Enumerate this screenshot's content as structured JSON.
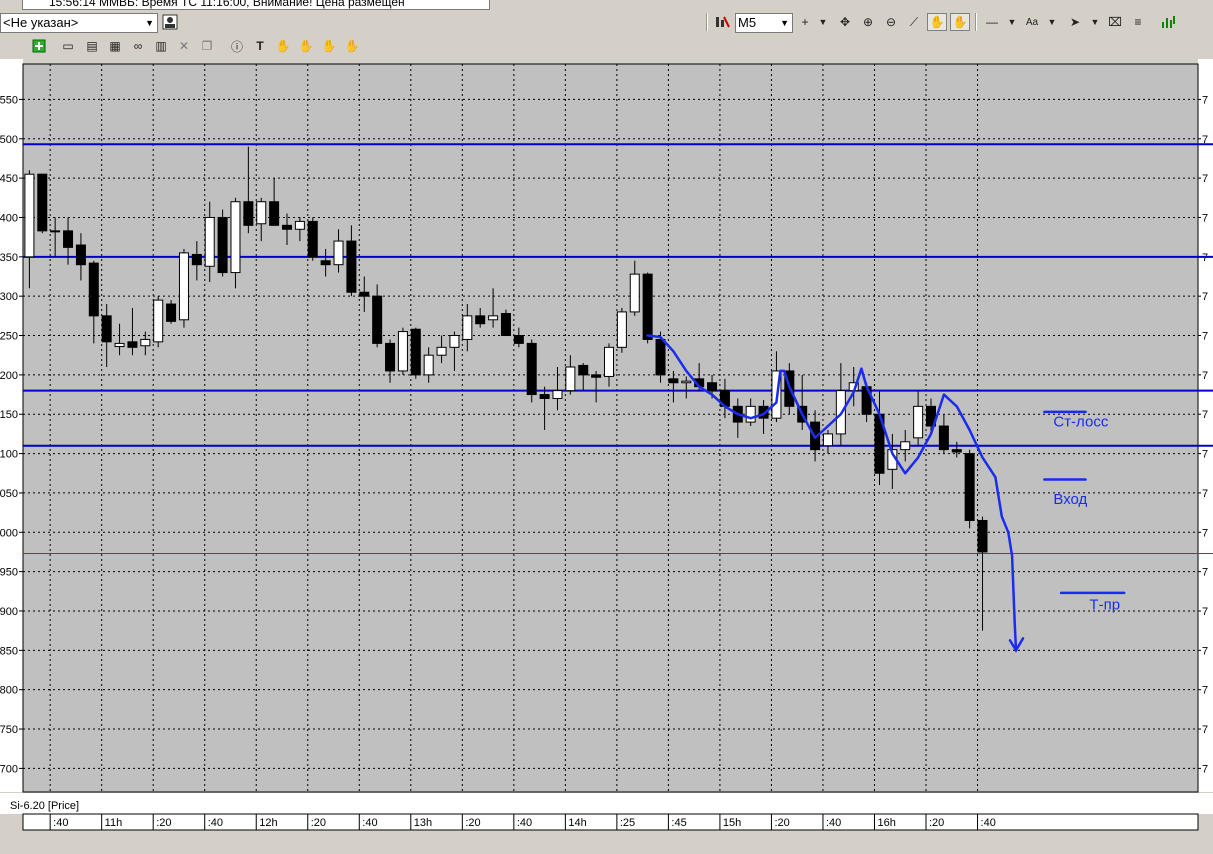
{
  "window": {
    "title": "15:56:14 ММВБ: Время ТС   11:16:00, Внимание! Цена размещен"
  },
  "toolbar": {
    "instrument_select": "<Не указан>",
    "timeframe_select": "M5"
  },
  "colors": {
    "plot_bg": "#c0c0c0",
    "grid": "#000000",
    "level_line": "#0000cc",
    "current_price_line": "#ff0000",
    "annotation": "#1a2cf0",
    "candle_up": "#ffffff",
    "candle_down": "#000000"
  },
  "chart_data": {
    "type": "candlestick",
    "series_label": "Si-6.20 [Price]",
    "price_axis_left_labels": [
      {
        "price": 550,
        "text": "550"
      },
      {
        "price": 500,
        "text": "500"
      },
      {
        "price": 450,
        "text": "450"
      },
      {
        "price": 400,
        "text": "400"
      },
      {
        "price": 350,
        "text": "350"
      },
      {
        "price": 300,
        "text": "300"
      },
      {
        "price": 250,
        "text": "250"
      },
      {
        "price": 200,
        "text": "200"
      },
      {
        "price": 150,
        "text": "150"
      },
      {
        "price": 100,
        "text": "100"
      },
      {
        "price": 50,
        "text": "050"
      },
      {
        "price": 0,
        "text": "000"
      },
      {
        "price": -50,
        "text": "950"
      },
      {
        "price": -100,
        "text": "900"
      },
      {
        "price": -150,
        "text": "850"
      },
      {
        "price": -200,
        "text": "800"
      },
      {
        "price": -250,
        "text": "750"
      },
      {
        "price": -300,
        "text": "700"
      }
    ],
    "price_axis_right_label": "7",
    "ylim": [
      -330,
      595
    ],
    "time_axis_labels": [
      {
        "slot": 2,
        "text": ":40"
      },
      {
        "slot": 6,
        "text": "11h"
      },
      {
        "slot": 10,
        "text": ":20"
      },
      {
        "slot": 14,
        "text": ":40"
      },
      {
        "slot": 18,
        "text": "12h"
      },
      {
        "slot": 22,
        "text": ":20"
      },
      {
        "slot": 26,
        "text": ":40"
      },
      {
        "slot": 30,
        "text": "13h"
      },
      {
        "slot": 34,
        "text": ":20"
      },
      {
        "slot": 38,
        "text": ":40"
      },
      {
        "slot": 42,
        "text": "14h"
      },
      {
        "slot": 46,
        "text": ":25"
      },
      {
        "slot": 50,
        "text": ":45"
      },
      {
        "slot": 54,
        "text": "15h"
      },
      {
        "slot": 58,
        "text": ":20"
      },
      {
        "slot": 62,
        "text": ":40"
      },
      {
        "slot": 66,
        "text": "16h"
      },
      {
        "slot": 70,
        "text": ":20"
      },
      {
        "slot": 74,
        "text": ":40"
      }
    ],
    "candles": [
      {
        "o": 350,
        "h": 460,
        "l": 310,
        "c": 455
      },
      {
        "o": 455,
        "h": 455,
        "l": 380,
        "c": 383
      },
      {
        "o": 383,
        "h": 400,
        "l": 350,
        "c": 383
      },
      {
        "o": 383,
        "h": 400,
        "l": 340,
        "c": 362
      },
      {
        "o": 365,
        "h": 380,
        "l": 320,
        "c": 340
      },
      {
        "o": 342,
        "h": 345,
        "l": 240,
        "c": 275
      },
      {
        "o": 275,
        "h": 290,
        "l": 210,
        "c": 242
      },
      {
        "o": 236,
        "h": 265,
        "l": 225,
        "c": 240
      },
      {
        "o": 242,
        "h": 285,
        "l": 225,
        "c": 235
      },
      {
        "o": 237,
        "h": 255,
        "l": 225,
        "c": 245
      },
      {
        "o": 242,
        "h": 300,
        "l": 235,
        "c": 295
      },
      {
        "o": 290,
        "h": 295,
        "l": 265,
        "c": 268
      },
      {
        "o": 270,
        "h": 360,
        "l": 260,
        "c": 355
      },
      {
        "o": 353,
        "h": 370,
        "l": 320,
        "c": 340
      },
      {
        "o": 338,
        "h": 420,
        "l": 318,
        "c": 400
      },
      {
        "o": 400,
        "h": 410,
        "l": 325,
        "c": 330
      },
      {
        "o": 330,
        "h": 425,
        "l": 310,
        "c": 420
      },
      {
        "o": 420,
        "h": 490,
        "l": 380,
        "c": 390
      },
      {
        "o": 392,
        "h": 425,
        "l": 370,
        "c": 420
      },
      {
        "o": 420,
        "h": 450,
        "l": 390,
        "c": 390
      },
      {
        "o": 390,
        "h": 405,
        "l": 365,
        "c": 385
      },
      {
        "o": 385,
        "h": 400,
        "l": 370,
        "c": 395
      },
      {
        "o": 395,
        "h": 400,
        "l": 345,
        "c": 350
      },
      {
        "o": 345,
        "h": 360,
        "l": 325,
        "c": 340
      },
      {
        "o": 340,
        "h": 385,
        "l": 330,
        "c": 370
      },
      {
        "o": 370,
        "h": 390,
        "l": 300,
        "c": 305
      },
      {
        "o": 305,
        "h": 325,
        "l": 280,
        "c": 300
      },
      {
        "o": 300,
        "h": 315,
        "l": 235,
        "c": 240
      },
      {
        "o": 240,
        "h": 245,
        "l": 190,
        "c": 205
      },
      {
        "o": 205,
        "h": 260,
        "l": 200,
        "c": 255
      },
      {
        "o": 258,
        "h": 260,
        "l": 195,
        "c": 200
      },
      {
        "o": 200,
        "h": 235,
        "l": 190,
        "c": 225
      },
      {
        "o": 225,
        "h": 250,
        "l": 215,
        "c": 235
      },
      {
        "o": 235,
        "h": 255,
        "l": 205,
        "c": 250
      },
      {
        "o": 245,
        "h": 290,
        "l": 230,
        "c": 275
      },
      {
        "o": 275,
        "h": 285,
        "l": 260,
        "c": 265
      },
      {
        "o": 270,
        "h": 310,
        "l": 260,
        "c": 275
      },
      {
        "o": 278,
        "h": 283,
        "l": 255,
        "c": 250
      },
      {
        "o": 250,
        "h": 260,
        "l": 235,
        "c": 240
      },
      {
        "o": 240,
        "h": 245,
        "l": 165,
        "c": 175
      },
      {
        "o": 175,
        "h": 185,
        "l": 130,
        "c": 170
      },
      {
        "o": 170,
        "h": 210,
        "l": 155,
        "c": 180
      },
      {
        "o": 180,
        "h": 225,
        "l": 175,
        "c": 210
      },
      {
        "o": 212,
        "h": 215,
        "l": 180,
        "c": 200
      },
      {
        "o": 200,
        "h": 205,
        "l": 165,
        "c": 197
      },
      {
        "o": 198,
        "h": 240,
        "l": 185,
        "c": 235
      },
      {
        "o": 235,
        "h": 285,
        "l": 228,
        "c": 280
      },
      {
        "o": 280,
        "h": 345,
        "l": 275,
        "c": 328
      },
      {
        "o": 328,
        "h": 330,
        "l": 240,
        "c": 245
      },
      {
        "o": 245,
        "h": 255,
        "l": 190,
        "c": 200
      },
      {
        "o": 195,
        "h": 205,
        "l": 165,
        "c": 190
      },
      {
        "o": 190,
        "h": 198,
        "l": 170,
        "c": 192
      },
      {
        "o": 195,
        "h": 215,
        "l": 180,
        "c": 185
      },
      {
        "o": 190,
        "h": 200,
        "l": 170,
        "c": 180
      },
      {
        "o": 180,
        "h": 195,
        "l": 145,
        "c": 160
      },
      {
        "o": 160,
        "h": 170,
        "l": 120,
        "c": 140
      },
      {
        "o": 140,
        "h": 170,
        "l": 135,
        "c": 160
      },
      {
        "o": 160,
        "h": 168,
        "l": 125,
        "c": 145
      },
      {
        "o": 145,
        "h": 230,
        "l": 140,
        "c": 205
      },
      {
        "o": 205,
        "h": 215,
        "l": 150,
        "c": 160
      },
      {
        "o": 160,
        "h": 200,
        "l": 130,
        "c": 140
      },
      {
        "o": 140,
        "h": 155,
        "l": 90,
        "c": 105
      },
      {
        "o": 110,
        "h": 130,
        "l": 100,
        "c": 125
      },
      {
        "o": 125,
        "h": 215,
        "l": 110,
        "c": 180
      },
      {
        "o": 180,
        "h": 210,
        "l": 160,
        "c": 190
      },
      {
        "o": 185,
        "h": 190,
        "l": 140,
        "c": 150
      },
      {
        "o": 150,
        "h": 180,
        "l": 60,
        "c": 75
      },
      {
        "o": 80,
        "h": 125,
        "l": 55,
        "c": 105
      },
      {
        "o": 105,
        "h": 130,
        "l": 90,
        "c": 115
      },
      {
        "o": 120,
        "h": 180,
        "l": 110,
        "c": 160
      },
      {
        "o": 160,
        "h": 170,
        "l": 125,
        "c": 135
      },
      {
        "o": 135,
        "h": 150,
        "l": 100,
        "c": 105
      },
      {
        "o": 105,
        "h": 115,
        "l": 95,
        "c": 102
      },
      {
        "o": 100,
        "h": 105,
        "l": 5,
        "c": 15
      },
      {
        "o": 15,
        "h": 20,
        "l": -125,
        "c": -25
      }
    ],
    "horizontal_levels": [
      {
        "price": 493,
        "color": "#0000cc"
      },
      {
        "price": 350,
        "color": "#0000cc"
      },
      {
        "price": 180,
        "color": "#0000cc"
      },
      {
        "price": 110,
        "color": "#0000cc"
      },
      {
        "price": -27,
        "color": "#ff0000"
      }
    ],
    "annotations": [
      {
        "text": "Ст-лосс",
        "slot": 79.5,
        "price": 141
      },
      {
        "text": "Вход",
        "slot": 79.5,
        "price": 42
      },
      {
        "text": "Т-пр",
        "slot": 82.3,
        "price": -92
      }
    ]
  }
}
